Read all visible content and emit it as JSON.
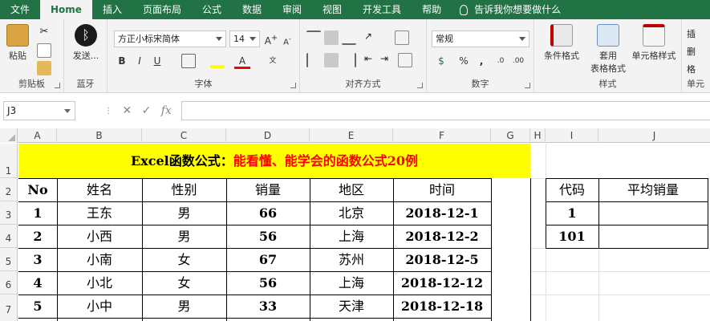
{
  "tabs": [
    "文件",
    "Home",
    "插入",
    "页面布局",
    "公式",
    "数据",
    "审阅",
    "视图",
    "开发工具",
    "帮助"
  ],
  "active_tab": "Home",
  "tellme": "告诉我你想要做什么",
  "ribbon": {
    "clipboard": {
      "paste": "粘贴",
      "label": "剪贴板"
    },
    "bluetooth": {
      "send": "发送...",
      "label": "蓝牙"
    },
    "font": {
      "name": "方正小标宋简体",
      "size": "14",
      "label": "字体"
    },
    "alignment": {
      "label": "对齐方式"
    },
    "number": {
      "format": "常规",
      "label": "数字"
    },
    "styles": {
      "conditional": "条件格式",
      "table1": "套用",
      "table2": "表格格式",
      "cellstyle": "单元格样式",
      "label": "样式"
    },
    "cells": {
      "label": "单元",
      "insert": "插",
      "delete": "删",
      "format": "格"
    }
  },
  "formula": {
    "name_box": "J3",
    "fx": "fx",
    "value": ""
  },
  "columns": [
    "A",
    "B",
    "C",
    "D",
    "E",
    "F",
    "G",
    "H",
    "I",
    "J"
  ],
  "rows": [
    "1",
    "2",
    "3",
    "4",
    "5",
    "6",
    "7"
  ],
  "title": {
    "black": "Excel函数公式：",
    "red": "能看懂、能学会的函数公式20例"
  },
  "table": {
    "headers": [
      "No",
      "姓名",
      "性别",
      "销量",
      "地区",
      "时间"
    ],
    "rows": [
      [
        "1",
        "王东",
        "男",
        "66",
        "北京",
        "2018-12-1"
      ],
      [
        "2",
        "小西",
        "男",
        "56",
        "上海",
        "2018-12-2"
      ],
      [
        "3",
        "小南",
        "女",
        "67",
        "苏州",
        "2018-12-5"
      ],
      [
        "4",
        "小北",
        "女",
        "56",
        "上海",
        "2018-12-12"
      ],
      [
        "5",
        "小中",
        "男",
        "33",
        "天津",
        "2018-12-18"
      ]
    ]
  },
  "side_table": {
    "headers": [
      "代码",
      "平均销量"
    ],
    "rows": [
      [
        "1",
        ""
      ],
      [
        "101",
        ""
      ]
    ]
  },
  "colors": {
    "excel_green": "#217346",
    "title_fill": "#ffff00",
    "title_red": "#ff0000"
  }
}
